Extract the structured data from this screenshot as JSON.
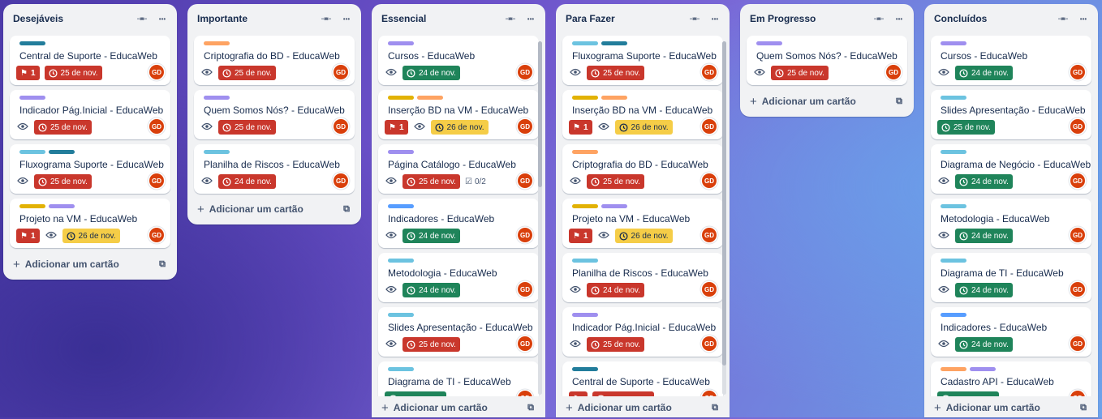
{
  "colors": {
    "purple": "#9f8fef",
    "orange": "#fea362",
    "teal": "#227d9b",
    "sky": "#6cc3e0",
    "yellow": "#e2b203",
    "blue": "#579dff",
    "red": "#c9372c",
    "green": "#1f845a",
    "date_yellow": "#f5cd47"
  },
  "lists": [
    {
      "title": "Desejáveis",
      "add_label": "Adicionar um cartão",
      "cards": [
        {
          "title": "Central de Suporte - EducaWeb",
          "labels": [
            "teal"
          ],
          "badges": [
            {
              "type": "flag",
              "text": "1"
            },
            {
              "type": "date",
              "status": "red",
              "text": "25 de nov."
            }
          ],
          "avatar": "GD"
        },
        {
          "title": "Indicador Pág.Inicial - EducaWeb",
          "labels": [
            "purple"
          ],
          "badges": [
            {
              "type": "eye"
            },
            {
              "type": "date",
              "status": "red",
              "text": "25 de nov."
            }
          ],
          "avatar": "GD"
        },
        {
          "title": "Fluxograma Suporte - EducaWeb",
          "labels": [
            "sky",
            "teal"
          ],
          "badges": [
            {
              "type": "eye"
            },
            {
              "type": "date",
              "status": "red",
              "text": "25 de nov."
            }
          ],
          "avatar": "GD"
        },
        {
          "title": "Projeto na VM - EducaWeb",
          "labels": [
            "yellow",
            "purple"
          ],
          "badges": [
            {
              "type": "flag",
              "text": "1"
            },
            {
              "type": "eye"
            },
            {
              "type": "date",
              "status": "yellow",
              "text": "26 de nov."
            }
          ],
          "avatar": "GD"
        }
      ]
    },
    {
      "title": "Importante",
      "add_label": "Adicionar um cartão",
      "cards": [
        {
          "title": "Criptografia do BD - EducaWeb",
          "labels": [
            "orange"
          ],
          "badges": [
            {
              "type": "eye"
            },
            {
              "type": "date",
              "status": "red",
              "text": "25 de nov."
            }
          ],
          "avatar": "GD"
        },
        {
          "title": "Quem Somos Nós? - EducaWeb",
          "labels": [
            "purple"
          ],
          "badges": [
            {
              "type": "eye"
            },
            {
              "type": "date",
              "status": "red",
              "text": "25 de nov."
            }
          ],
          "avatar": "GD"
        },
        {
          "title": "Planilha de Riscos - EducaWeb",
          "labels": [
            "sky"
          ],
          "badges": [
            {
              "type": "eye"
            },
            {
              "type": "date",
              "status": "red",
              "text": "24 de nov."
            }
          ],
          "avatar": "GD"
        }
      ]
    },
    {
      "title": "Essencial",
      "add_label": "Adicionar um cartão",
      "cards": [
        {
          "title": "Cursos - EducaWeb",
          "labels": [
            "purple"
          ],
          "badges": [
            {
              "type": "eye"
            },
            {
              "type": "date",
              "status": "green",
              "text": "24 de nov."
            }
          ],
          "avatar": "GD"
        },
        {
          "title": "Inserção BD na VM - EducaWeb",
          "labels": [
            "yellow",
            "orange"
          ],
          "badges": [
            {
              "type": "flag",
              "text": "1"
            },
            {
              "type": "eye"
            },
            {
              "type": "date",
              "status": "yellow",
              "text": "26 de nov."
            }
          ],
          "avatar": "GD"
        },
        {
          "title": "Página Catálogo - EducaWeb",
          "labels": [
            "purple"
          ],
          "badges": [
            {
              "type": "eye"
            },
            {
              "type": "date",
              "status": "red",
              "text": "25 de nov."
            },
            {
              "type": "check",
              "text": "0/2"
            }
          ],
          "avatar": "GD"
        },
        {
          "title": "Indicadores - EducaWeb",
          "labels": [
            "blue"
          ],
          "badges": [
            {
              "type": "eye"
            },
            {
              "type": "date",
              "status": "green",
              "text": "24 de nov."
            }
          ],
          "avatar": "GD"
        },
        {
          "title": "Metodologia - EducaWeb",
          "labels": [
            "sky"
          ],
          "badges": [
            {
              "type": "eye"
            },
            {
              "type": "date",
              "status": "green",
              "text": "24 de nov."
            }
          ],
          "avatar": "GD"
        },
        {
          "title": "Slides Apresentação - EducaWeb",
          "labels": [
            "sky"
          ],
          "badges": [
            {
              "type": "eye"
            },
            {
              "type": "date",
              "status": "red",
              "text": "25 de nov."
            }
          ],
          "avatar": "GD"
        },
        {
          "title": "Diagrama de TI - EducaWeb",
          "labels": [
            "sky"
          ],
          "badges": [
            {
              "type": "date",
              "status": "green",
              "text": ""
            }
          ],
          "avatar": "GD"
        }
      ]
    },
    {
      "title": "Para Fazer",
      "add_label": "Adicionar um cartão",
      "cards": [
        {
          "title": "Fluxograma Suporte - EducaWeb",
          "labels": [
            "sky",
            "teal"
          ],
          "badges": [
            {
              "type": "eye"
            },
            {
              "type": "date",
              "status": "red",
              "text": "25 de nov."
            }
          ],
          "avatar": "GD"
        },
        {
          "title": "Inserção BD na VM - EducaWeb",
          "labels": [
            "yellow",
            "orange"
          ],
          "badges": [
            {
              "type": "flag",
              "text": "1"
            },
            {
              "type": "eye"
            },
            {
              "type": "date",
              "status": "yellow",
              "text": "26 de nov."
            }
          ],
          "avatar": "GD"
        },
        {
          "title": "Criptografia do BD - EducaWeb",
          "labels": [
            "orange"
          ],
          "badges": [
            {
              "type": "eye"
            },
            {
              "type": "date",
              "status": "red",
              "text": "25 de nov."
            }
          ],
          "avatar": "GD"
        },
        {
          "title": "Projeto na VM - EducaWeb",
          "labels": [
            "yellow",
            "purple"
          ],
          "badges": [
            {
              "type": "flag",
              "text": "1"
            },
            {
              "type": "eye"
            },
            {
              "type": "date",
              "status": "yellow",
              "text": "26 de nov."
            }
          ],
          "avatar": "GD"
        },
        {
          "title": "Planilha de Riscos - EducaWeb",
          "labels": [
            "sky"
          ],
          "badges": [
            {
              "type": "eye"
            },
            {
              "type": "date",
              "status": "red",
              "text": "24 de nov."
            }
          ],
          "avatar": "GD"
        },
        {
          "title": "Indicador Pág.Inicial - EducaWeb",
          "labels": [
            "purple"
          ],
          "badges": [
            {
              "type": "eye"
            },
            {
              "type": "date",
              "status": "red",
              "text": "25 de nov."
            }
          ],
          "avatar": "GD"
        },
        {
          "title": "Central de Suporte - EducaWeb",
          "labels": [
            "teal"
          ],
          "badges": [
            {
              "type": "flag",
              "text": ""
            },
            {
              "type": "date",
              "status": "red",
              "text": ""
            }
          ],
          "avatar": "GD"
        }
      ]
    },
    {
      "title": "Em Progresso",
      "add_label": "Adicionar um cartão",
      "cards": [
        {
          "title": "Quem Somos Nós? - EducaWeb",
          "labels": [
            "purple"
          ],
          "badges": [
            {
              "type": "eye"
            },
            {
              "type": "date",
              "status": "red",
              "text": "25 de nov."
            }
          ],
          "avatar": "GD"
        }
      ]
    },
    {
      "title": "Concluídos",
      "add_label": "Adicionar um cartão",
      "cards": [
        {
          "title": "Cursos - EducaWeb",
          "labels": [
            "purple"
          ],
          "badges": [
            {
              "type": "eye"
            },
            {
              "type": "date",
              "status": "green",
              "text": "24 de nov."
            }
          ],
          "avatar": "GD"
        },
        {
          "title": "Slides Apresentação - EducaWeb",
          "labels": [
            "sky"
          ],
          "badges": [
            {
              "type": "date",
              "status": "green",
              "text": "25 de nov."
            }
          ],
          "avatar": "GD"
        },
        {
          "title": "Diagrama de Negócio - EducaWeb",
          "labels": [
            "sky"
          ],
          "badges": [
            {
              "type": "eye"
            },
            {
              "type": "date",
              "status": "green",
              "text": "24 de nov."
            }
          ],
          "avatar": "GD"
        },
        {
          "title": "Metodologia - EducaWeb",
          "labels": [
            "sky"
          ],
          "badges": [
            {
              "type": "eye"
            },
            {
              "type": "date",
              "status": "green",
              "text": "24 de nov."
            }
          ],
          "avatar": "GD"
        },
        {
          "title": "Diagrama de TI - EducaWeb",
          "labels": [
            "sky"
          ],
          "badges": [
            {
              "type": "eye"
            },
            {
              "type": "date",
              "status": "green",
              "text": "24 de nov."
            }
          ],
          "avatar": "GD"
        },
        {
          "title": "Indicadores - EducaWeb",
          "labels": [
            "blue"
          ],
          "badges": [
            {
              "type": "eye"
            },
            {
              "type": "date",
              "status": "green",
              "text": "24 de nov."
            }
          ],
          "avatar": "GD"
        },
        {
          "title": "Cadastro API - EducaWeb",
          "labels": [
            "orange",
            "purple"
          ],
          "badges": [
            {
              "type": "date",
              "status": "green",
              "text": ""
            }
          ],
          "avatar": "GD"
        }
      ]
    }
  ]
}
